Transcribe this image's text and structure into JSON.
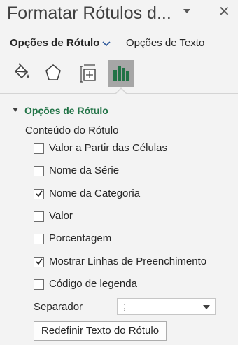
{
  "pane": {
    "title": "Formatar Rótulos d...",
    "dropdown_icon": "triangle-down-icon",
    "close_label": "✕"
  },
  "tabs": {
    "label_options": "Opções de Rótulo",
    "text_options": "Opções de Texto"
  },
  "icons": [
    "fill-line-icon",
    "effects-pentagon-icon",
    "size-properties-icon",
    "label-options-bar-chart-icon"
  ],
  "section": {
    "title": "Opções de Rótulo",
    "group_label": "Conteúdo do Rótulo"
  },
  "checkboxes": [
    {
      "label": "Valor a Partir das Células",
      "checked": false
    },
    {
      "label": "Nome da Série",
      "checked": false
    },
    {
      "label": "Nome da Categoria",
      "checked": true
    },
    {
      "label": "Valor",
      "checked": false
    },
    {
      "label": "Porcentagem",
      "checked": false
    },
    {
      "label": "Mostrar Linhas de Preenchimento",
      "checked": true
    },
    {
      "label": "Código de legenda",
      "checked": false
    }
  ],
  "separator": {
    "label": "Separador",
    "value": ";"
  },
  "reset_button": "Redefinir Texto do Rótulo",
  "colors": {
    "accent_green": "#217346",
    "background": "#f3f3f3",
    "selected_icon_bg": "#a6a6a6"
  }
}
